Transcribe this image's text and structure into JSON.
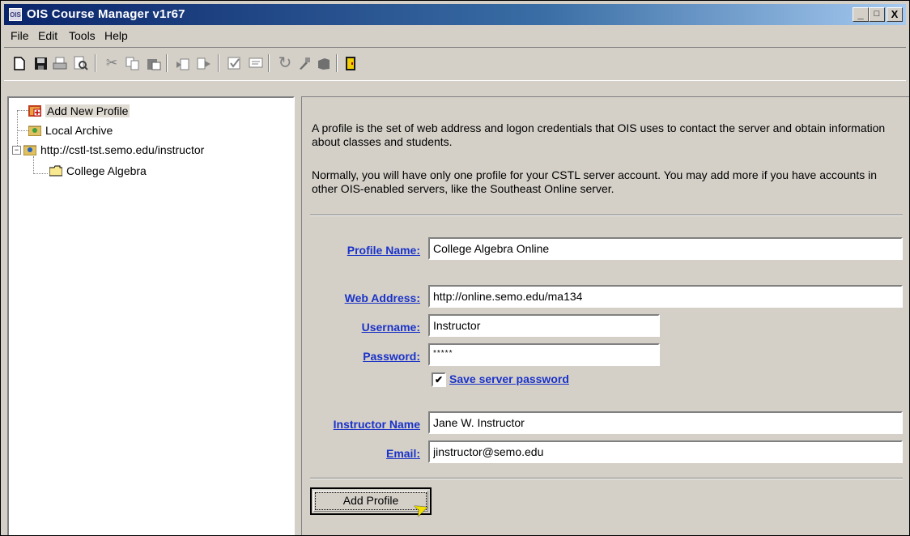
{
  "window": {
    "title": "OIS Course Manager v1r67",
    "icon_label": "OIS",
    "title_gradient_start": "#0a246a",
    "title_gradient_end": "#a6caf0",
    "buttons": {
      "minimize": "_",
      "maximize": "□",
      "close": "X"
    }
  },
  "menubar": [
    {
      "label": "File",
      "icon": ""
    },
    {
      "label": "Edit"
    },
    {
      "label": "Tools"
    },
    {
      "label": "Help"
    }
  ],
  "toolbar": {
    "icons": [
      "new-icon",
      "save-icon",
      "print-icon",
      "print-preview-icon",
      "cut-icon",
      "copy-icon",
      "paste-icon",
      "import-icon",
      "export-icon",
      "grade-icon",
      "report-icon",
      "refresh-icon",
      "tool-icon",
      "archive-icon",
      "exit-door-icon"
    ]
  },
  "tree": {
    "items": [
      {
        "label": "Add New Profile",
        "icon": "add-profile-icon",
        "selected": true
      },
      {
        "label": "Local Archive",
        "icon": "archive-folder-icon"
      },
      {
        "label": "http://cstl-tst.semo.edu/instructor",
        "icon": "server-icon",
        "expander": "−"
      },
      {
        "label": "College Algebra",
        "icon": "folder-icon"
      }
    ]
  },
  "form": {
    "intro_1": "A profile is the set of web address and logon credentials that OIS uses to contact the server and obtain information about classes and students.",
    "intro_2": "Normally, you will have only one profile for your CSTL server account.  You may add more if you have accounts in other OIS-enabled servers, like the Southeast Online server.",
    "profile_name_label": "Profile Name:",
    "profile_name_value": "College Algebra Online",
    "web_address_label": "Web Address:",
    "web_address_value": "http://online.semo.edu/ma134",
    "username_label": "Username:",
    "username_value": "Instructor",
    "password_label": "Password:",
    "password_value": "*****",
    "save_password_label": "Save server password",
    "save_password_checked": true,
    "instructor_name_label": "Instructor Name",
    "instructor_name_value": "Jane W. Instructor",
    "email_label": "Email:",
    "email_value": "jinstructor@semo.edu",
    "add_profile_button": "Add Profile",
    "link_color": "#1a32c8"
  }
}
